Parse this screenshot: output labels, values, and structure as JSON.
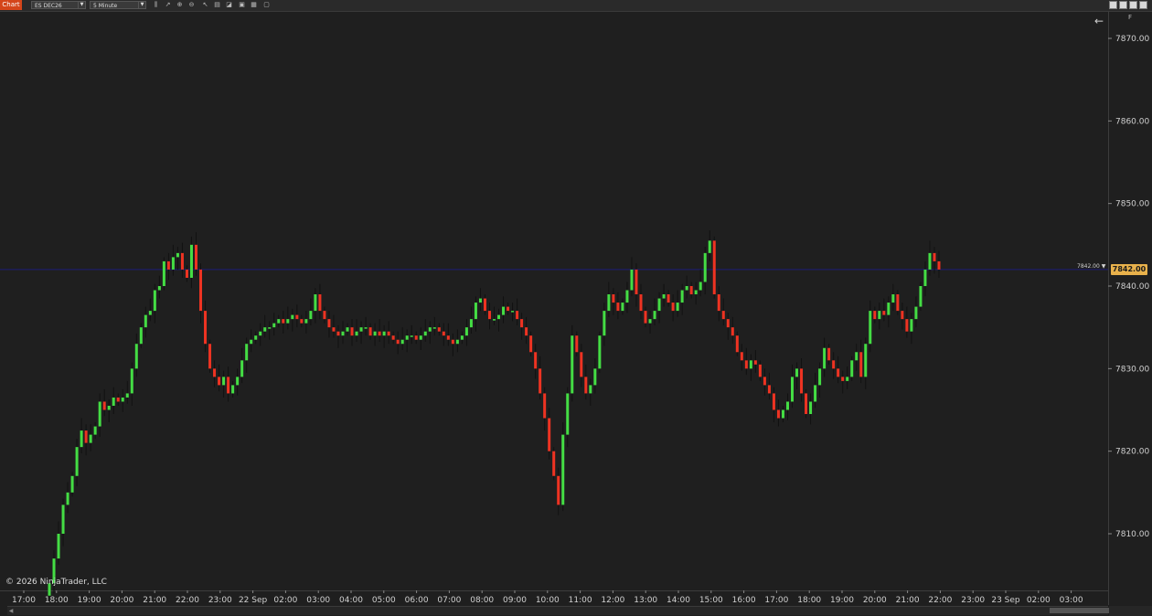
{
  "toolbar": {
    "badge": "Chart",
    "instrument": "ES DEC26",
    "interval": "5 Minute",
    "icons": [
      "bars-icon",
      "candles-icon",
      "pencil-icon",
      "zoom-in-icon",
      "zoom-out-icon",
      "pointer-icon",
      "properties-icon",
      "indicators-icon",
      "strategies-icon",
      "template-icon",
      "screenshot-icon"
    ]
  },
  "chart": {
    "copyright": "© 2026 NinjaTrader, LLC",
    "panel_label": "F",
    "last_price_badge": "7842.00",
    "last_price_small": "7842.00 ▼"
  },
  "colors": {
    "up": "#44dd44",
    "down": "#ee3322",
    "wick": "#111111",
    "last_line": "#1c1c78",
    "badge": "#e8b14b"
  },
  "chart_data": {
    "type": "candlestick",
    "instrument": "ES DEC26",
    "interval": "5 Minute",
    "y_ticks": [
      7810,
      7820,
      7830,
      7840,
      7850,
      7860,
      7870
    ],
    "y_tick_labels": [
      "7810.00",
      "7820.00",
      "7830.00",
      "7840.00",
      "7850.00",
      "7860.00",
      "7870.00"
    ],
    "ylim": [
      7804,
      7871
    ],
    "x_tick_labels": [
      "17:00",
      "18:00",
      "19:00",
      "20:00",
      "21:00",
      "22:00",
      "23:00",
      "22 Sep",
      "02:00",
      "03:00",
      "04:00",
      "05:00",
      "06:00",
      "07:00",
      "08:00",
      "09:00",
      "10:00",
      "11:00",
      "12:00",
      "13:00",
      "14:00",
      "15:00",
      "16:00",
      "17:00",
      "18:00",
      "19:00",
      "20:00",
      "21:00",
      "22:00",
      "23:00",
      "23 Sep",
      "02:00",
      "03:00"
    ],
    "last_price": 7842.0,
    "closes": [
      7804,
      7807,
      7810,
      7813.5,
      7815,
      7817,
      7820.5,
      7822.5,
      7821,
      7822,
      7823,
      7826,
      7825,
      7825.5,
      7826.5,
      7826,
      7826.5,
      7827,
      7830,
      7833,
      7835,
      7836.5,
      7837,
      7839.5,
      7840,
      7843,
      7842,
      7843.5,
      7844,
      7842,
      7841,
      7845,
      7842,
      7837,
      7833,
      7830,
      7829,
      7828,
      7829,
      7827,
      7828,
      7829,
      7831,
      7833,
      7833.5,
      7834,
      7834.5,
      7835,
      7835,
      7835.5,
      7836,
      7835.5,
      7836,
      7836.5,
      7836,
      7835.5,
      7836,
      7837,
      7839,
      7837,
      7836,
      7835,
      7834.5,
      7834,
      7834.5,
      7835,
      7834,
      7834.5,
      7835,
      7835,
      7834,
      7834.5,
      7834,
      7834.5,
      7834,
      7833.5,
      7833,
      7833.5,
      7834,
      7834,
      7833.5,
      7834,
      7834.5,
      7835,
      7835,
      7834.5,
      7834,
      7833.5,
      7833,
      7833.5,
      7834,
      7835,
      7836,
      7838,
      7838.5,
      7837,
      7836,
      7836,
      7836.5,
      7837.5,
      7837,
      7837,
      7836,
      7835,
      7834,
      7832,
      7830,
      7827,
      7824,
      7820,
      7817,
      7813.5,
      7822,
      7827,
      7834,
      7832,
      7829,
      7827,
      7828,
      7830,
      7834,
      7837,
      7839,
      7838,
      7837,
      7838,
      7839.5,
      7842,
      7839,
      7837,
      7835.5,
      7836,
      7837,
      7838.5,
      7839,
      7838,
      7837,
      7838,
      7839.5,
      7840,
      7839,
      7839.5,
      7840.5,
      7844,
      7845.5,
      7839,
      7837,
      7836,
      7835,
      7834,
      7832,
      7831,
      7830,
      7831,
      7830.5,
      7829,
      7828,
      7827,
      7825,
      7824,
      7825,
      7826,
      7829,
      7830,
      7827,
      7824.5,
      7826,
      7828,
      7830,
      7832.5,
      7831,
      7830,
      7829,
      7828.5,
      7829,
      7831,
      7832,
      7829,
      7833,
      7837,
      7836,
      7837,
      7836.5,
      7838,
      7839,
      7837,
      7836,
      7834.5,
      7836,
      7837.5,
      7840,
      7842,
      7844,
      7843,
      7842
    ]
  }
}
